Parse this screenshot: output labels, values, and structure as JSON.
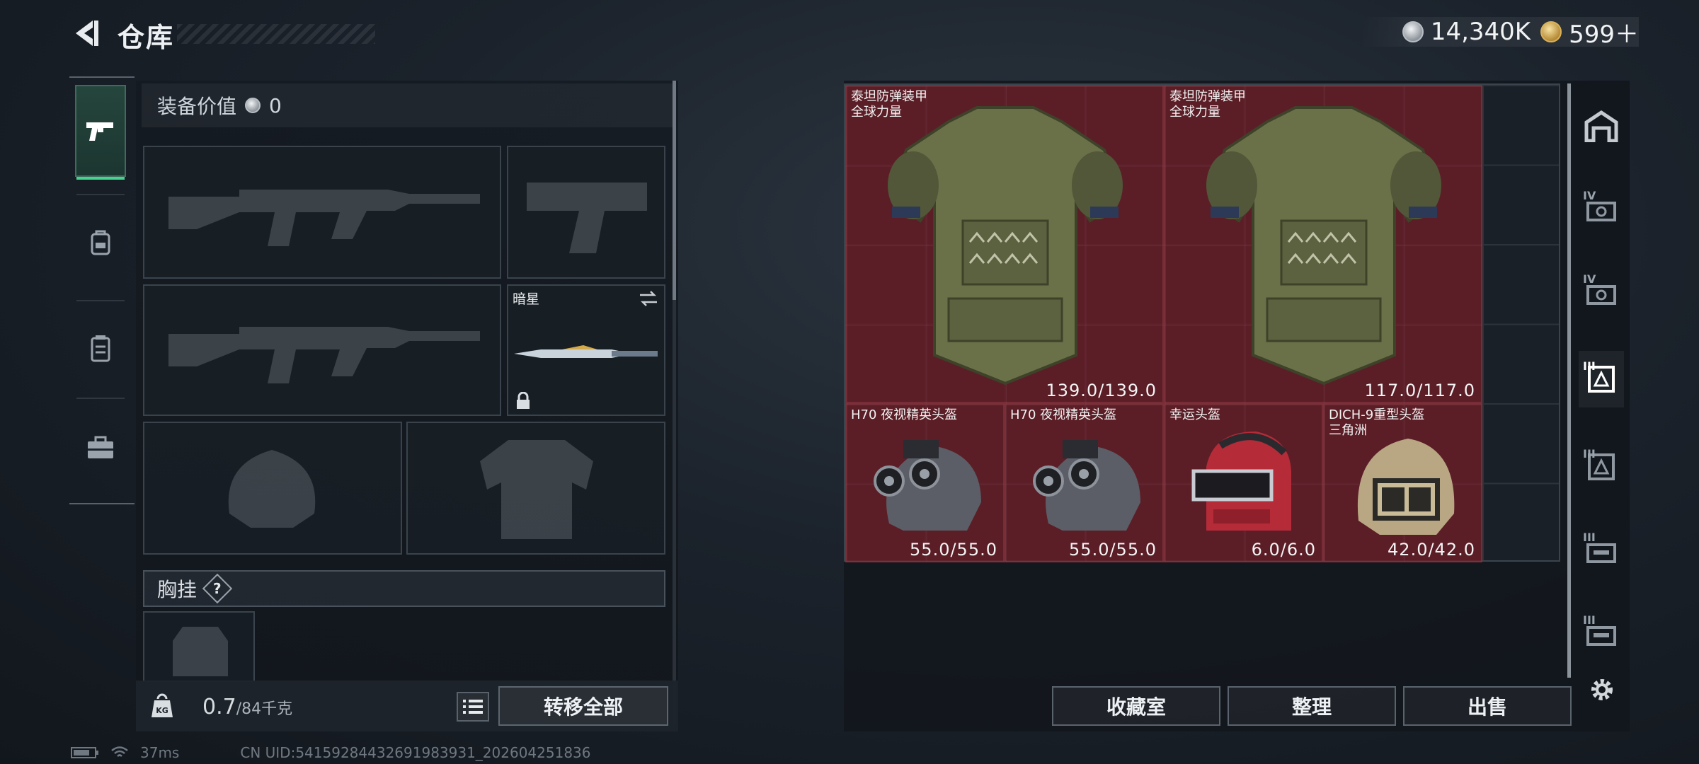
{
  "header": {
    "title": "仓库",
    "currencies": [
      {
        "icon": "silver-coin-icon",
        "value": "14,340K"
      },
      {
        "icon": "gold-coin-icon",
        "value": "599＋"
      }
    ]
  },
  "equipment": {
    "value_label": "装备价值",
    "value": "0",
    "melee_name": "暗星",
    "chest_label": "胸挂",
    "help_mark": "?",
    "weight_value": "0.7",
    "weight_capacity": "/84千克",
    "transfer_all": "转移全部"
  },
  "warehouse": {
    "items": [
      {
        "name": "泰坦防弹装甲\n全球力量",
        "durability": "139.0/139.0"
      },
      {
        "name": "泰坦防弹装甲\n全球力量",
        "durability": "117.0/117.0"
      },
      {
        "name": "H70 夜视精英头盔",
        "durability": "55.0/55.0"
      },
      {
        "name": "H70 夜视精英头盔",
        "durability": "55.0/55.0"
      },
      {
        "name": "幸运头盔",
        "durability": "6.0/6.0"
      },
      {
        "name": "DICH-9重型头盔\n三角洲",
        "durability": "42.0/42.0"
      }
    ],
    "buttons": {
      "collection": "收藏室",
      "organize": "整理",
      "sell": "出售"
    }
  },
  "right_rail": {
    "roman": [
      "IV",
      "IV",
      "III",
      "III",
      "III",
      "III"
    ]
  },
  "status": {
    "ping": "37ms",
    "uid": "CN UID:54159284432691983931_202604251836"
  },
  "colors": {
    "accent_green": "#44d48f",
    "item_red": "#6e1e28"
  }
}
